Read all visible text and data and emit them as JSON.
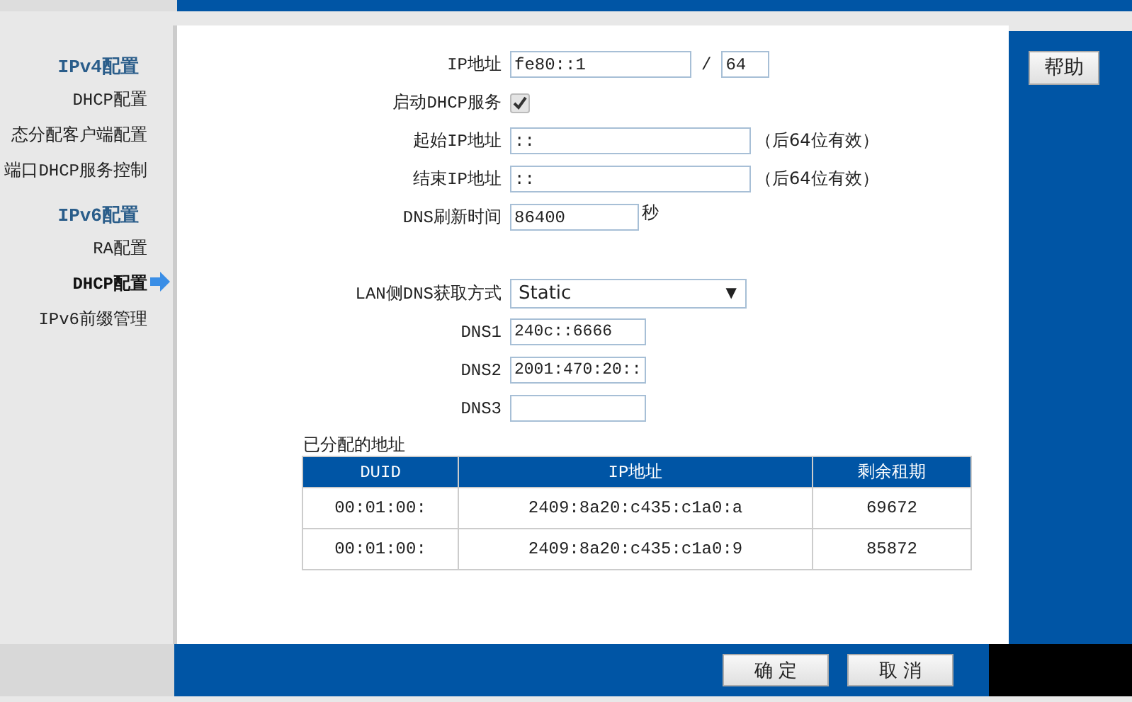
{
  "sidebar": {
    "groups": [
      {
        "title": "IPv4配置",
        "items": [
          {
            "label": "DHCP配置",
            "selected": false
          },
          {
            "label": "态分配客户端配置",
            "selected": false
          },
          {
            "label": "端口DHCP服务控制",
            "selected": false
          }
        ]
      },
      {
        "title": "IPv6配置",
        "items": [
          {
            "label": "RA配置",
            "selected": false
          },
          {
            "label": "DHCP配置",
            "selected": true
          },
          {
            "label": "IPv6前缀管理",
            "selected": false
          }
        ]
      }
    ]
  },
  "form": {
    "ip": {
      "label": "IP地址",
      "value": "fe80::1",
      "separator": "/",
      "prefix": "64"
    },
    "dhcp": {
      "label": "启动DHCP服务",
      "checked": true
    },
    "start": {
      "label": "起始IP地址",
      "value": "::",
      "note": "（后64位有效）"
    },
    "end": {
      "label": "结束IP地址",
      "value": "::",
      "note": "（后64位有效）"
    },
    "refresh": {
      "label": "DNS刷新时间",
      "value": "86400",
      "unit": "秒"
    },
    "lan_dns": {
      "label": "LAN侧DNS获取方式",
      "value": "Static",
      "caret": "▼"
    },
    "dns": [
      {
        "label": "DNS1",
        "value": "240c::6666"
      },
      {
        "label": "DNS2",
        "value": "2001:470:20::"
      },
      {
        "label": "DNS3"
      }
    ]
  },
  "table": {
    "title": "已分配的地址",
    "columns": [
      "DUID",
      "IP地址",
      "剩余租期"
    ],
    "rows": [
      [
        "00:01:00:",
        "2409:8a20:c435:c1a0:a",
        "69672"
      ],
      [
        "00:01:00:",
        "2409:8a20:c435:c1a0:9",
        "85872"
      ]
    ]
  },
  "help_button": "帮助",
  "buttons": [
    "确 定",
    "取 消"
  ]
}
